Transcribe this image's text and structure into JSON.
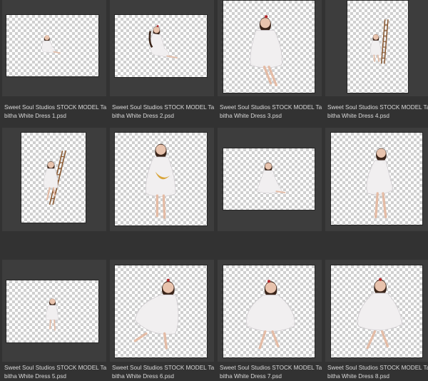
{
  "files": [
    {
      "name": "Sweet Soul Studios STOCK MODEL Tabitha White Dress 1.psd",
      "pose": "sitting-small"
    },
    {
      "name": "Sweet Soul Studios STOCK MODEL Tabitha White Dress 2.psd",
      "pose": "sitting-hug"
    },
    {
      "name": "Sweet Soul Studios STOCK MODEL Tabitha White Dress 3.psd",
      "pose": "sitting-front"
    },
    {
      "name": "Sweet Soul Studios STOCK MODEL Tabitha White Dress 4.psd",
      "pose": "ladder-right"
    },
    {
      "name": "Sweet Soul Studios STOCK MODEL Tabitha White Dress 5.psd",
      "pose": "ladder-left"
    },
    {
      "name": "Sweet Soul Studios STOCK MODEL Tabitha White Dress 6.psd",
      "pose": "standing-moon"
    },
    {
      "name": "Sweet Soul Studios STOCK MODEL Tabitha White Dress 7.psd",
      "pose": "kneeling"
    },
    {
      "name": "Sweet Soul Studios STOCK MODEL Tabitha White Dress 8.psd",
      "pose": "standing-side"
    },
    {
      "name": "",
      "pose": "standing-small"
    },
    {
      "name": "",
      "pose": "twirl-left"
    },
    {
      "name": "",
      "pose": "twirl-front"
    },
    {
      "name": "",
      "pose": "twirl-right"
    }
  ]
}
